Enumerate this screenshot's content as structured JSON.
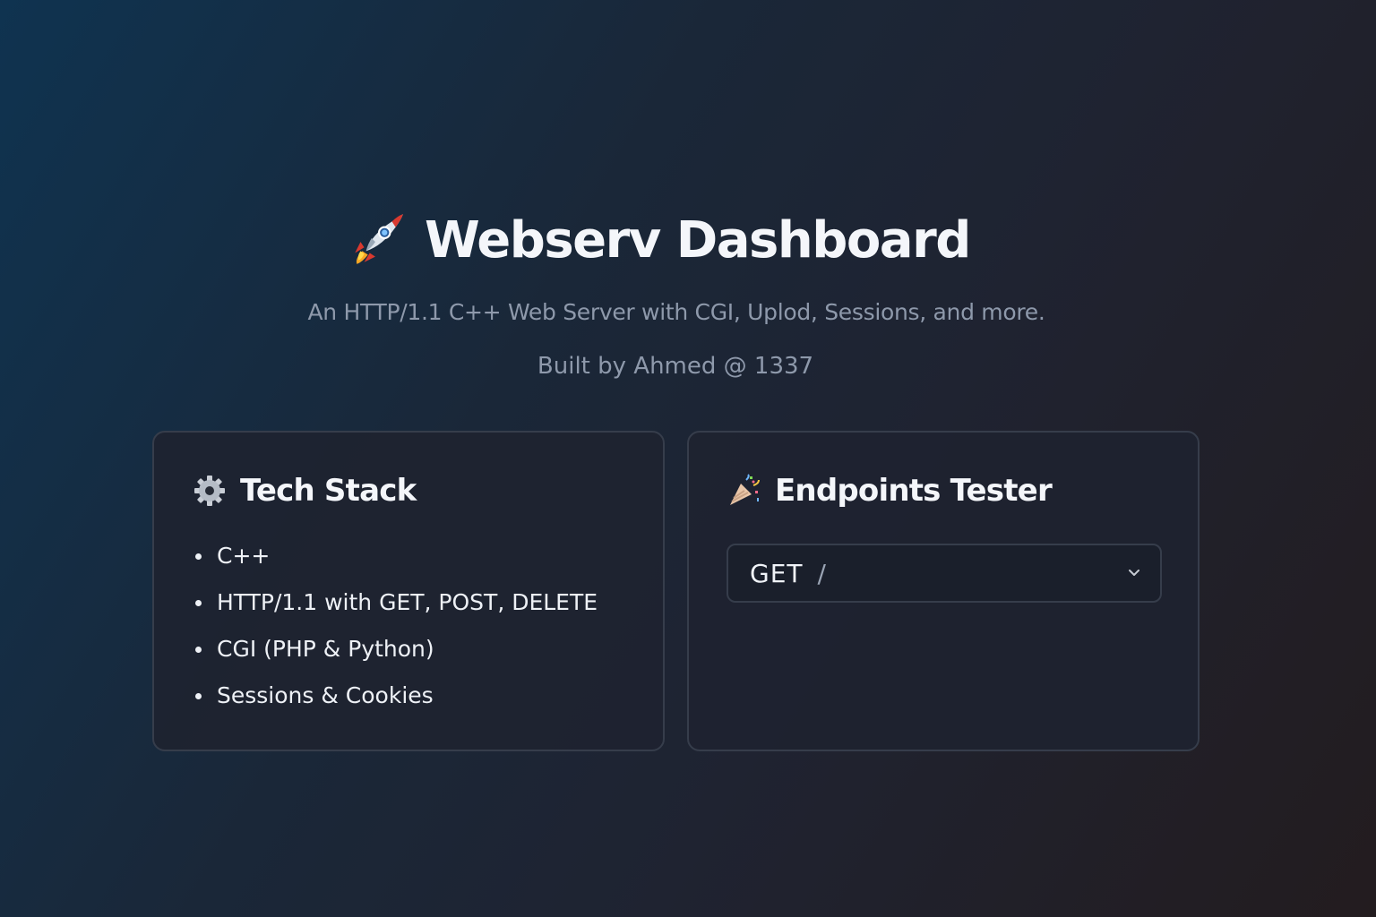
{
  "header": {
    "title": "Webserv Dashboard",
    "icon": "rocket-icon",
    "subtitle": "An HTTP/1.1 C++ Web Server with CGI, Uplod, Sessions, and more.",
    "credit": "Built by Ahmed @ 1337"
  },
  "tech_stack": {
    "icon": "gear-icon",
    "title": "Tech Stack",
    "items": [
      "C++",
      "HTTP/1.1 with GET, POST, DELETE",
      "CGI (PHP & Python)",
      "Sessions & Cookies"
    ]
  },
  "endpoints_tester": {
    "icon": "party-popper-icon",
    "title": "Endpoints Tester",
    "select": {
      "method": "GET",
      "path": "/"
    }
  },
  "colors": {
    "background_start": "#0f3350",
    "background_end": "#231c1f",
    "card_background": "#1e2330",
    "card_border": "#363d4b",
    "muted_text": "#8e99ab",
    "text": "#f4f6fa"
  }
}
